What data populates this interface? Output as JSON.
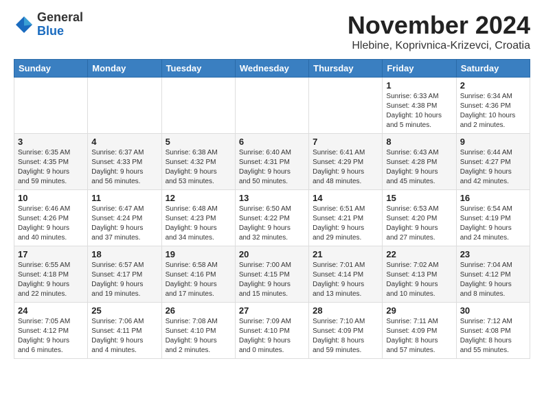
{
  "header": {
    "logo_general": "General",
    "logo_blue": "Blue",
    "month_year": "November 2024",
    "location": "Hlebine, Koprivnica-Krizevci, Croatia"
  },
  "days_of_week": [
    "Sunday",
    "Monday",
    "Tuesday",
    "Wednesday",
    "Thursday",
    "Friday",
    "Saturday"
  ],
  "weeks": [
    [
      {
        "day": "",
        "text": ""
      },
      {
        "day": "",
        "text": ""
      },
      {
        "day": "",
        "text": ""
      },
      {
        "day": "",
        "text": ""
      },
      {
        "day": "",
        "text": ""
      },
      {
        "day": "1",
        "text": "Sunrise: 6:33 AM\nSunset: 4:38 PM\nDaylight: 10 hours\nand 5 minutes."
      },
      {
        "day": "2",
        "text": "Sunrise: 6:34 AM\nSunset: 4:36 PM\nDaylight: 10 hours\nand 2 minutes."
      }
    ],
    [
      {
        "day": "3",
        "text": "Sunrise: 6:35 AM\nSunset: 4:35 PM\nDaylight: 9 hours\nand 59 minutes."
      },
      {
        "day": "4",
        "text": "Sunrise: 6:37 AM\nSunset: 4:33 PM\nDaylight: 9 hours\nand 56 minutes."
      },
      {
        "day": "5",
        "text": "Sunrise: 6:38 AM\nSunset: 4:32 PM\nDaylight: 9 hours\nand 53 minutes."
      },
      {
        "day": "6",
        "text": "Sunrise: 6:40 AM\nSunset: 4:31 PM\nDaylight: 9 hours\nand 50 minutes."
      },
      {
        "day": "7",
        "text": "Sunrise: 6:41 AM\nSunset: 4:29 PM\nDaylight: 9 hours\nand 48 minutes."
      },
      {
        "day": "8",
        "text": "Sunrise: 6:43 AM\nSunset: 4:28 PM\nDaylight: 9 hours\nand 45 minutes."
      },
      {
        "day": "9",
        "text": "Sunrise: 6:44 AM\nSunset: 4:27 PM\nDaylight: 9 hours\nand 42 minutes."
      }
    ],
    [
      {
        "day": "10",
        "text": "Sunrise: 6:46 AM\nSunset: 4:26 PM\nDaylight: 9 hours\nand 40 minutes."
      },
      {
        "day": "11",
        "text": "Sunrise: 6:47 AM\nSunset: 4:24 PM\nDaylight: 9 hours\nand 37 minutes."
      },
      {
        "day": "12",
        "text": "Sunrise: 6:48 AM\nSunset: 4:23 PM\nDaylight: 9 hours\nand 34 minutes."
      },
      {
        "day": "13",
        "text": "Sunrise: 6:50 AM\nSunset: 4:22 PM\nDaylight: 9 hours\nand 32 minutes."
      },
      {
        "day": "14",
        "text": "Sunrise: 6:51 AM\nSunset: 4:21 PM\nDaylight: 9 hours\nand 29 minutes."
      },
      {
        "day": "15",
        "text": "Sunrise: 6:53 AM\nSunset: 4:20 PM\nDaylight: 9 hours\nand 27 minutes."
      },
      {
        "day": "16",
        "text": "Sunrise: 6:54 AM\nSunset: 4:19 PM\nDaylight: 9 hours\nand 24 minutes."
      }
    ],
    [
      {
        "day": "17",
        "text": "Sunrise: 6:55 AM\nSunset: 4:18 PM\nDaylight: 9 hours\nand 22 minutes."
      },
      {
        "day": "18",
        "text": "Sunrise: 6:57 AM\nSunset: 4:17 PM\nDaylight: 9 hours\nand 19 minutes."
      },
      {
        "day": "19",
        "text": "Sunrise: 6:58 AM\nSunset: 4:16 PM\nDaylight: 9 hours\nand 17 minutes."
      },
      {
        "day": "20",
        "text": "Sunrise: 7:00 AM\nSunset: 4:15 PM\nDaylight: 9 hours\nand 15 minutes."
      },
      {
        "day": "21",
        "text": "Sunrise: 7:01 AM\nSunset: 4:14 PM\nDaylight: 9 hours\nand 13 minutes."
      },
      {
        "day": "22",
        "text": "Sunrise: 7:02 AM\nSunset: 4:13 PM\nDaylight: 9 hours\nand 10 minutes."
      },
      {
        "day": "23",
        "text": "Sunrise: 7:04 AM\nSunset: 4:12 PM\nDaylight: 9 hours\nand 8 minutes."
      }
    ],
    [
      {
        "day": "24",
        "text": "Sunrise: 7:05 AM\nSunset: 4:12 PM\nDaylight: 9 hours\nand 6 minutes."
      },
      {
        "day": "25",
        "text": "Sunrise: 7:06 AM\nSunset: 4:11 PM\nDaylight: 9 hours\nand 4 minutes."
      },
      {
        "day": "26",
        "text": "Sunrise: 7:08 AM\nSunset: 4:10 PM\nDaylight: 9 hours\nand 2 minutes."
      },
      {
        "day": "27",
        "text": "Sunrise: 7:09 AM\nSunset: 4:10 PM\nDaylight: 9 hours\nand 0 minutes."
      },
      {
        "day": "28",
        "text": "Sunrise: 7:10 AM\nSunset: 4:09 PM\nDaylight: 8 hours\nand 59 minutes."
      },
      {
        "day": "29",
        "text": "Sunrise: 7:11 AM\nSunset: 4:09 PM\nDaylight: 8 hours\nand 57 minutes."
      },
      {
        "day": "30",
        "text": "Sunrise: 7:12 AM\nSunset: 4:08 PM\nDaylight: 8 hours\nand 55 minutes."
      }
    ]
  ]
}
